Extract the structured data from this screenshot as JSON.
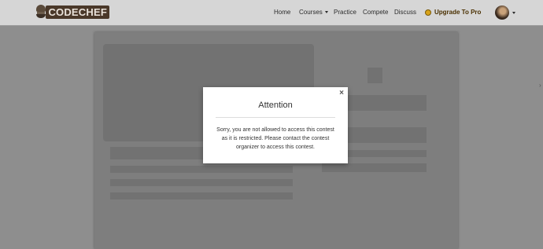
{
  "brand": {
    "logo_text": "CODECHEF"
  },
  "nav": {
    "home": "Home",
    "courses": "Courses",
    "practice": "Practice",
    "compete": "Compete",
    "discuss": "Discuss",
    "upgrade": "Upgrade To Pro"
  },
  "modal": {
    "close": "×",
    "title": "Attention",
    "body_lines": [
      "Sorry, you are not allowed to access this contest",
      "as it is restricted. Please contact the contest",
      "organizer to access this contest."
    ]
  },
  "colors": {
    "pro_accent": "#d8a31a",
    "overlay": "#8e8e8e"
  }
}
